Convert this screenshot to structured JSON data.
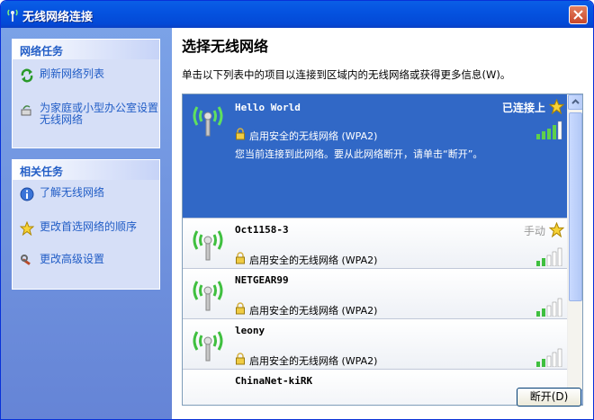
{
  "window": {
    "title": "无线网络连接"
  },
  "sidebar": {
    "network_tasks": {
      "header": "网络任务",
      "items": [
        {
          "label": "刷新网络列表"
        },
        {
          "label": "为家庭或小型办公室设置无线网络"
        }
      ]
    },
    "related_tasks": {
      "header": "相关任务",
      "items": [
        {
          "label": "了解无线网络"
        },
        {
          "label": "更改首选网络的顺序"
        },
        {
          "label": "更改高级设置"
        }
      ]
    }
  },
  "main": {
    "title": "选择无线网络",
    "description": "单击以下列表中的项目以连接到区域内的无线网络或获得更多信息(W)。",
    "networks": [
      {
        "ssid": "Hello World",
        "status": "已连接上",
        "security": "启用安全的无线网络 (WPA2)",
        "note": "您当前连接到此网络。要从此网络断开，请单击“断开”。",
        "signal": 0.8
      },
      {
        "ssid": "Oct1158-3",
        "status": "手动",
        "security": "启用安全的无线网络 (WPA2)",
        "signal": 0.4
      },
      {
        "ssid": "NETGEAR99",
        "status": "",
        "security": "启用安全的无线网络 (WPA2)",
        "signal": 0.4
      },
      {
        "ssid": "leony",
        "status": "",
        "security": "启用安全的无线网络 (WPA2)",
        "signal": 0.4
      },
      {
        "ssid": "ChinaNet-kiRK",
        "status": "",
        "security": "",
        "signal": 0
      }
    ],
    "disconnect_label": "断开(D)"
  },
  "colors": {
    "selected_bg": "#3168c6",
    "link": "#215dc6",
    "titlebar": "#0553e0"
  }
}
